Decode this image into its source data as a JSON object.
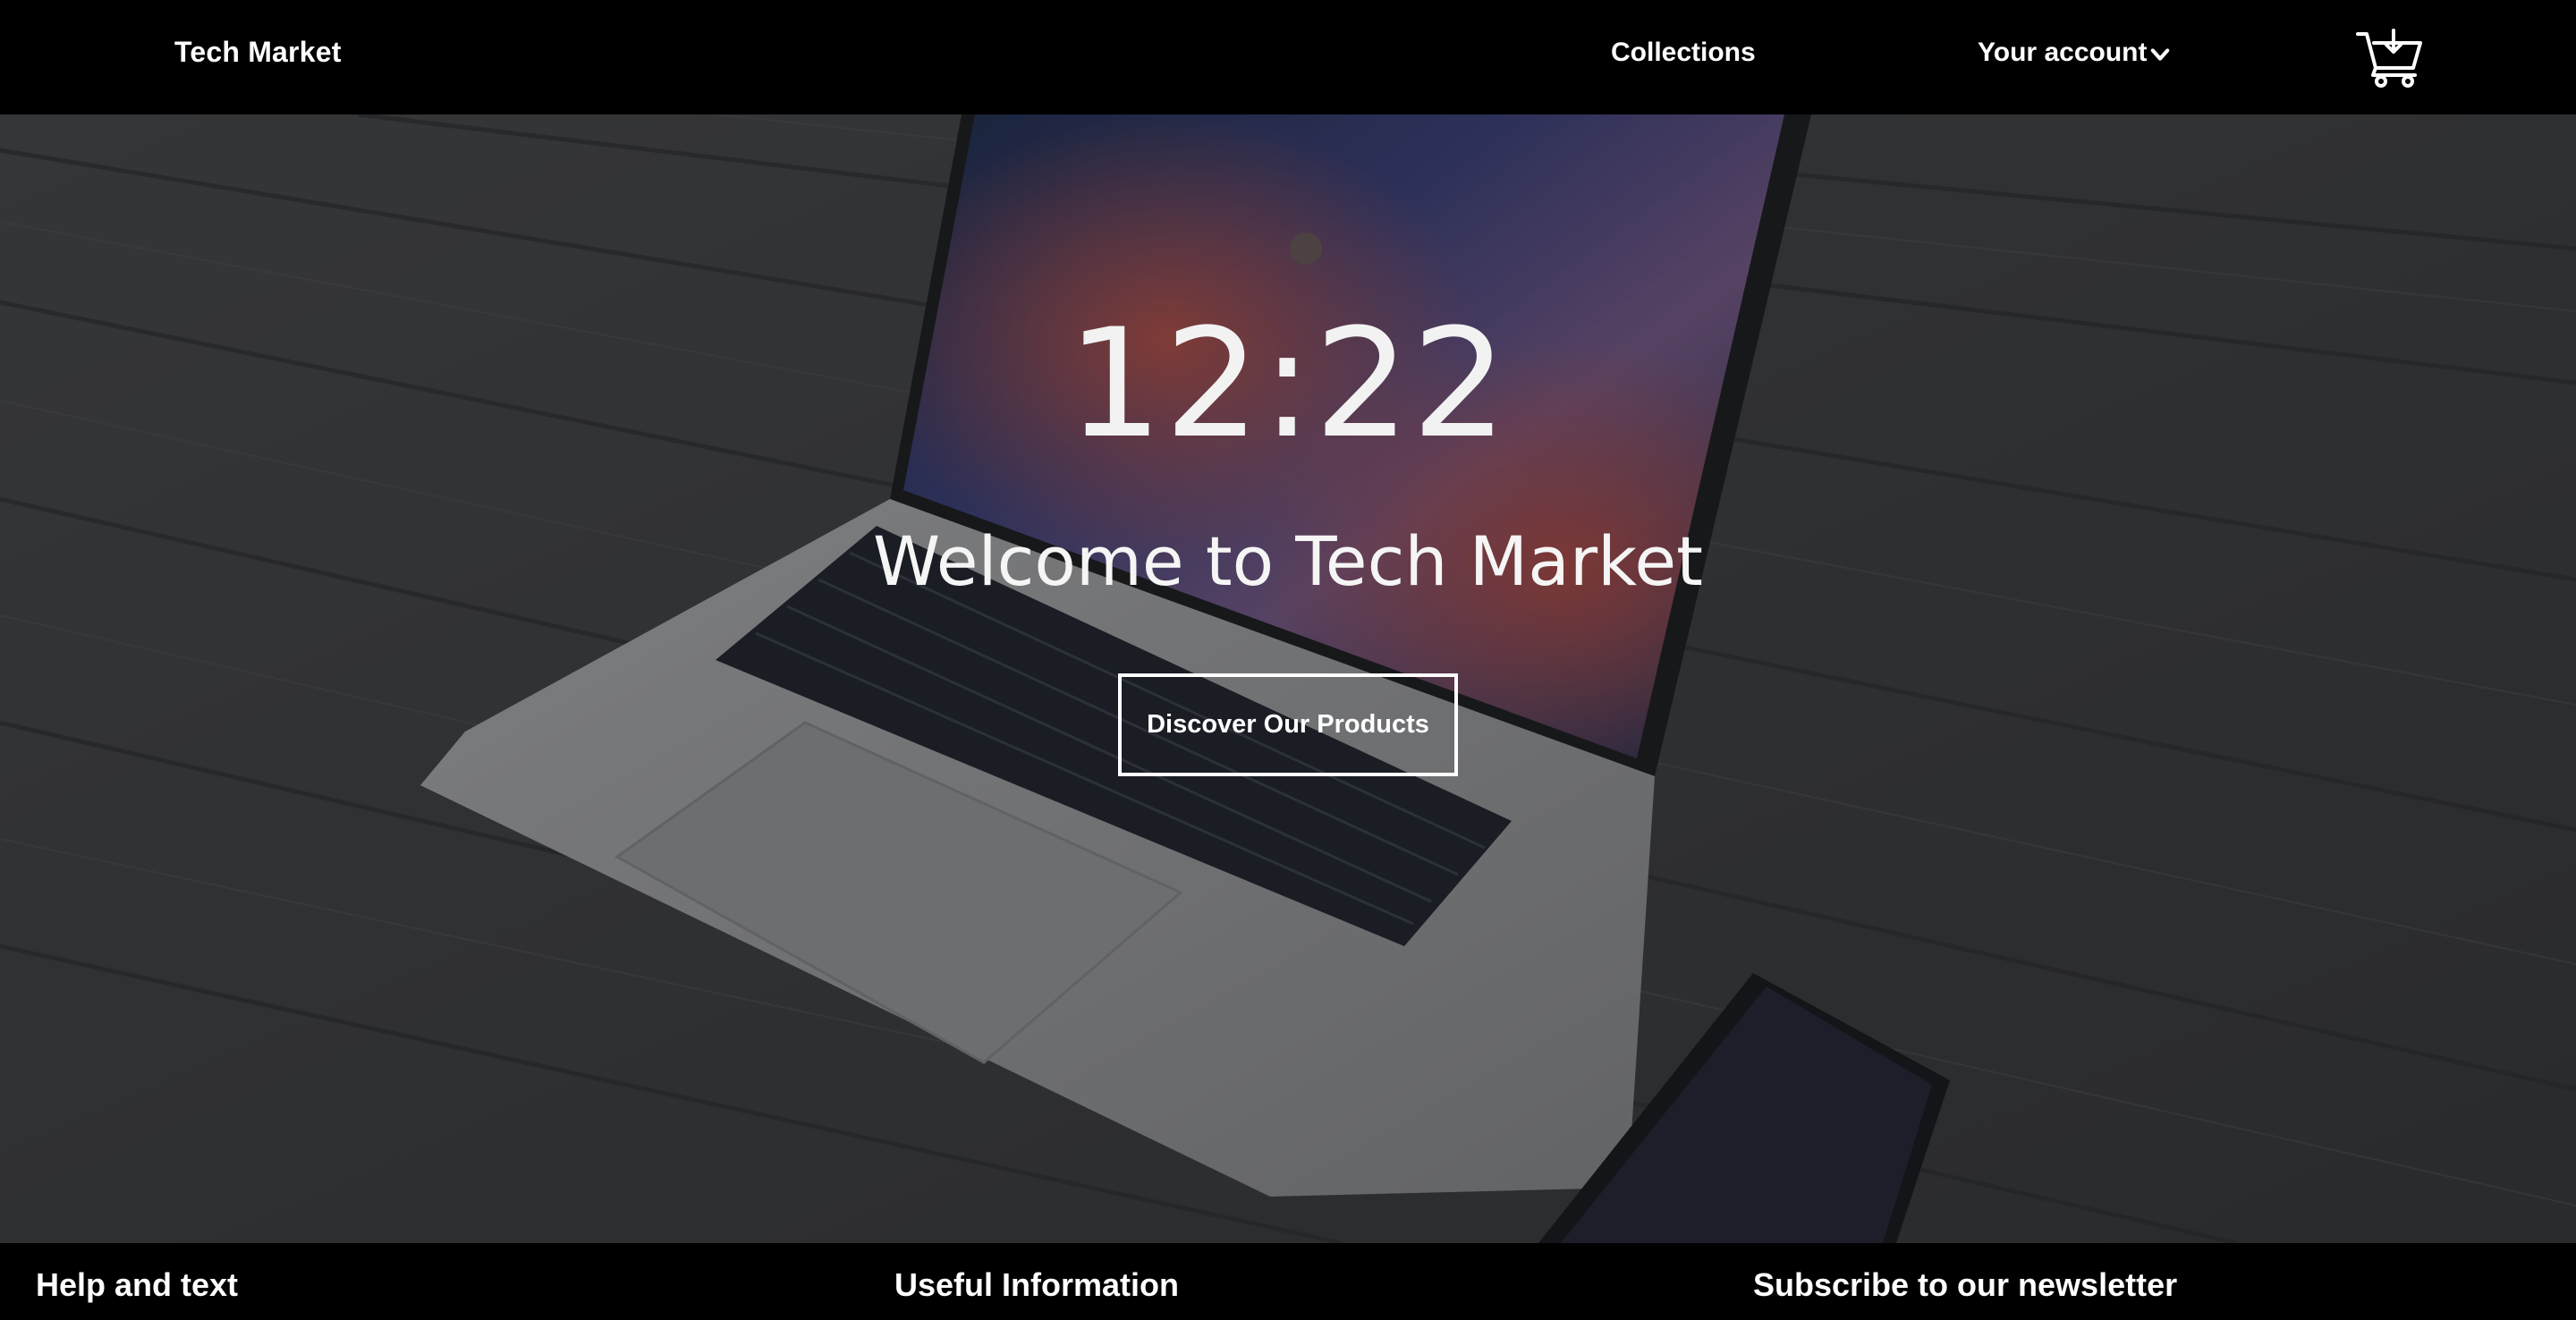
{
  "header": {
    "brand": "Tech Market",
    "nav": {
      "collections": "Collections",
      "account": "Your account"
    },
    "icons": {
      "account_chevron": "chevron-down-icon",
      "cart": "cart-download-icon"
    }
  },
  "hero": {
    "clock": "12:22",
    "title": "Welcome to Tech Market",
    "cta_label": "Discover Our Products",
    "background": "laptop-on-wooden-desk-photo"
  },
  "footer": {
    "col1_title": "Help and text",
    "col2_title": "Useful Information",
    "col3_title": "Subscribe to our newsletter"
  },
  "colors": {
    "header_bg": "#000000",
    "text": "#ffffff",
    "hero_overlay": "#14161e"
  }
}
